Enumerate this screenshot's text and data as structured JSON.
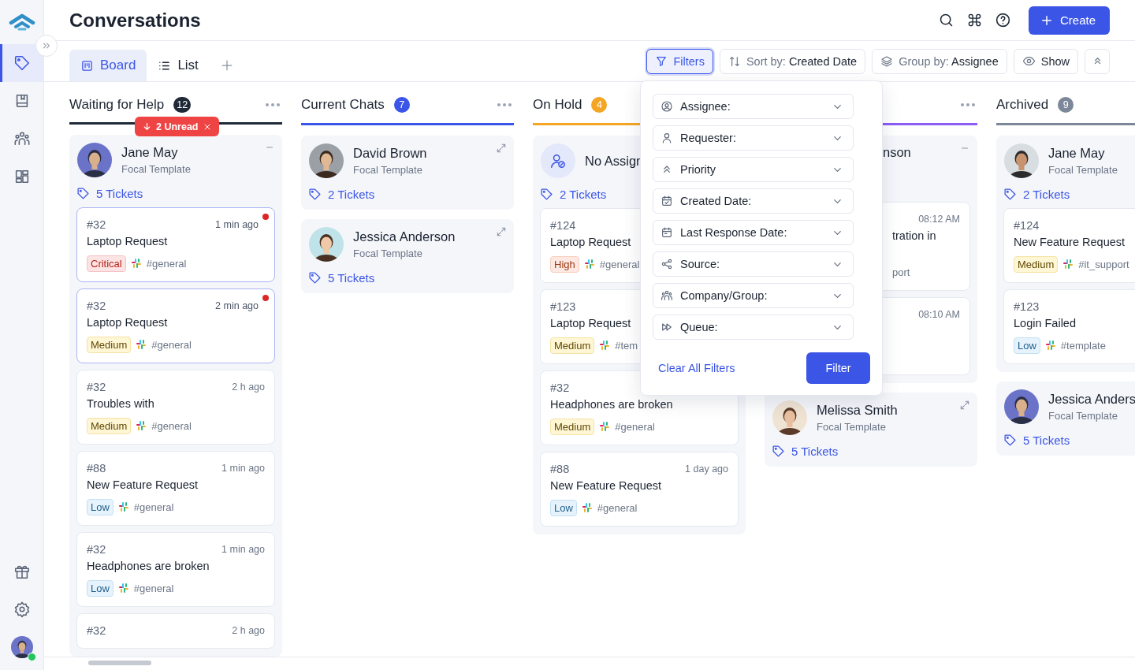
{
  "sidebar": {
    "items": [
      {
        "kind": "tag",
        "selected": true
      },
      {
        "kind": "book",
        "selected": false
      },
      {
        "kind": "people",
        "selected": false
      },
      {
        "kind": "grid",
        "selected": false
      }
    ],
    "bottom_items": [
      {
        "kind": "gift"
      },
      {
        "kind": "settings"
      }
    ],
    "user": {
      "online": true
    }
  },
  "header": {
    "title": "Conversations",
    "create_button": "Create"
  },
  "view_tabs": [
    {
      "label": "Board",
      "kind": "board",
      "selected": true
    },
    {
      "label": "List",
      "kind": "list",
      "selected": false
    }
  ],
  "toolbar": {
    "filters": {
      "label": "Filters",
      "active": true
    },
    "sort": {
      "prefix": "Sort by:",
      "value": "Created Date"
    },
    "group": {
      "prefix": "Group by:",
      "value": "Assignee"
    },
    "show": "Show"
  },
  "columns": [
    {
      "title": "Waiting for Help",
      "count": "12",
      "color": "#1f2937",
      "more_menu": true,
      "unread": "2 Unread",
      "groups": [
        {
          "name": "Jane May",
          "subtitle": "Focal Template",
          "tickets_label": "5 Tickets",
          "expanded": true,
          "tickets": [
            {
              "id": "#32",
              "time": "1 min ago",
              "title": "Laptop Request",
              "priority": {
                "label": "Critical",
                "kind": "critical"
              },
              "channel": "#general",
              "unread": true
            },
            {
              "id": "#32",
              "time": "2 min ago",
              "title": "Laptop Request",
              "priority": {
                "label": "Medium",
                "kind": "medium"
              },
              "channel": "#general",
              "unread": true
            },
            {
              "id": "#32",
              "time": "2 h ago",
              "title": "Troubles with",
              "priority": {
                "label": "Medium",
                "kind": "medium"
              },
              "channel": "#general",
              "unread": false
            },
            {
              "id": "#88",
              "time": "1 min ago",
              "title": "New Feature Request",
              "priority": {
                "label": "Low",
                "kind": "low"
              },
              "channel": "#general",
              "unread": false
            },
            {
              "id": "#32",
              "time": "1 min ago",
              "title": "Headphones are broken",
              "priority": {
                "label": "Low",
                "kind": "low"
              },
              "channel": "#general",
              "unread": false
            },
            {
              "id": "#32",
              "time": "2 h ago",
              "unread": false
            }
          ]
        }
      ]
    },
    {
      "title": "Current Chats",
      "count": "7",
      "color": "#3b55e6",
      "more_menu": true,
      "groups": [
        {
          "name": "David Brown",
          "subtitle": "Focal Template",
          "tickets_label": "2 Tickets",
          "expanded": false
        },
        {
          "name": "Jessica Anderson",
          "subtitle": "Focal Template",
          "tickets_label": "5 Tickets",
          "expanded": false
        }
      ]
    },
    {
      "title": "On Hold",
      "count": "4",
      "color": "#f5a524",
      "groups": [
        {
          "name": "No Assign",
          "tickets_label": "2 Tickets",
          "avatar": {
            "kind": "unassigned"
          },
          "tickets": [
            {
              "id": "#124",
              "title": "Laptop Request",
              "priority": {
                "label": "High",
                "kind": "high"
              },
              "channel": "#general",
              "unread": false
            },
            {
              "id": "#123",
              "title": "Laptop Request",
              "priority": {
                "label": "Medium",
                "kind": "medium"
              },
              "channel": "#tem",
              "unread": false
            },
            {
              "id": "#32",
              "title": "Headphones are broken",
              "priority": {
                "label": "Medium",
                "kind": "medium"
              },
              "channel": "#general",
              "unread": false
            },
            {
              "id": "#88",
              "time": "1 day ago",
              "title": "New Feature Request",
              "priority": {
                "label": "Low",
                "kind": "low"
              },
              "channel": "#general",
              "unread": false
            }
          ]
        }
      ]
    },
    {
      "color": "#8b5cf6",
      "more_menu": true,
      "groups": [
        {
          "kind": "partial",
          "name": "nson",
          "expanded": true,
          "tickets": [
            {
              "kind": "partial",
              "time": "08:12 AM",
              "title": "tration in",
              "channel": "port",
              "unread": false
            },
            {
              "kind": "partial",
              "time": "08:10 AM",
              "unread": false
            }
          ]
        },
        {
          "name": "Melissa Smith",
          "subtitle": "Focal Template",
          "tickets_label": "5 Tickets",
          "expanded": false
        }
      ]
    },
    {
      "title": "Archived",
      "count": "9",
      "color": "#7c8799",
      "groups": [
        {
          "name": "Jane May",
          "subtitle": "Focal Template",
          "tickets_label": "2 Tickets",
          "tickets": [
            {
              "id": "#124",
              "title": "New Feature Request",
              "priority": {
                "label": "Medium",
                "kind": "medium"
              },
              "channel": "#it_support",
              "unread": false
            },
            {
              "id": "#123",
              "title": "Login Failed",
              "priority": {
                "label": "Low",
                "kind": "low"
              },
              "channel": "#template",
              "unread": false
            }
          ]
        },
        {
          "name": "Jessica Anders",
          "subtitle": "Focal Template",
          "tickets_label": "5 Tickets"
        }
      ]
    }
  ],
  "filter_panel": {
    "fields": [
      {
        "kind": "assignee",
        "label": "Assignee:"
      },
      {
        "kind": "requester",
        "label": "Requester:"
      },
      {
        "kind": "priority",
        "label": "Priority"
      },
      {
        "kind": "created",
        "label": "Created Date:"
      },
      {
        "kind": "last_response",
        "label": "Last Response Date:"
      },
      {
        "kind": "source",
        "label": "Source:"
      },
      {
        "kind": "company",
        "label": "Company/Group:"
      },
      {
        "kind": "queue",
        "label": "Queue:"
      }
    ],
    "clear": "Clear All Filters",
    "apply": "Filter"
  }
}
